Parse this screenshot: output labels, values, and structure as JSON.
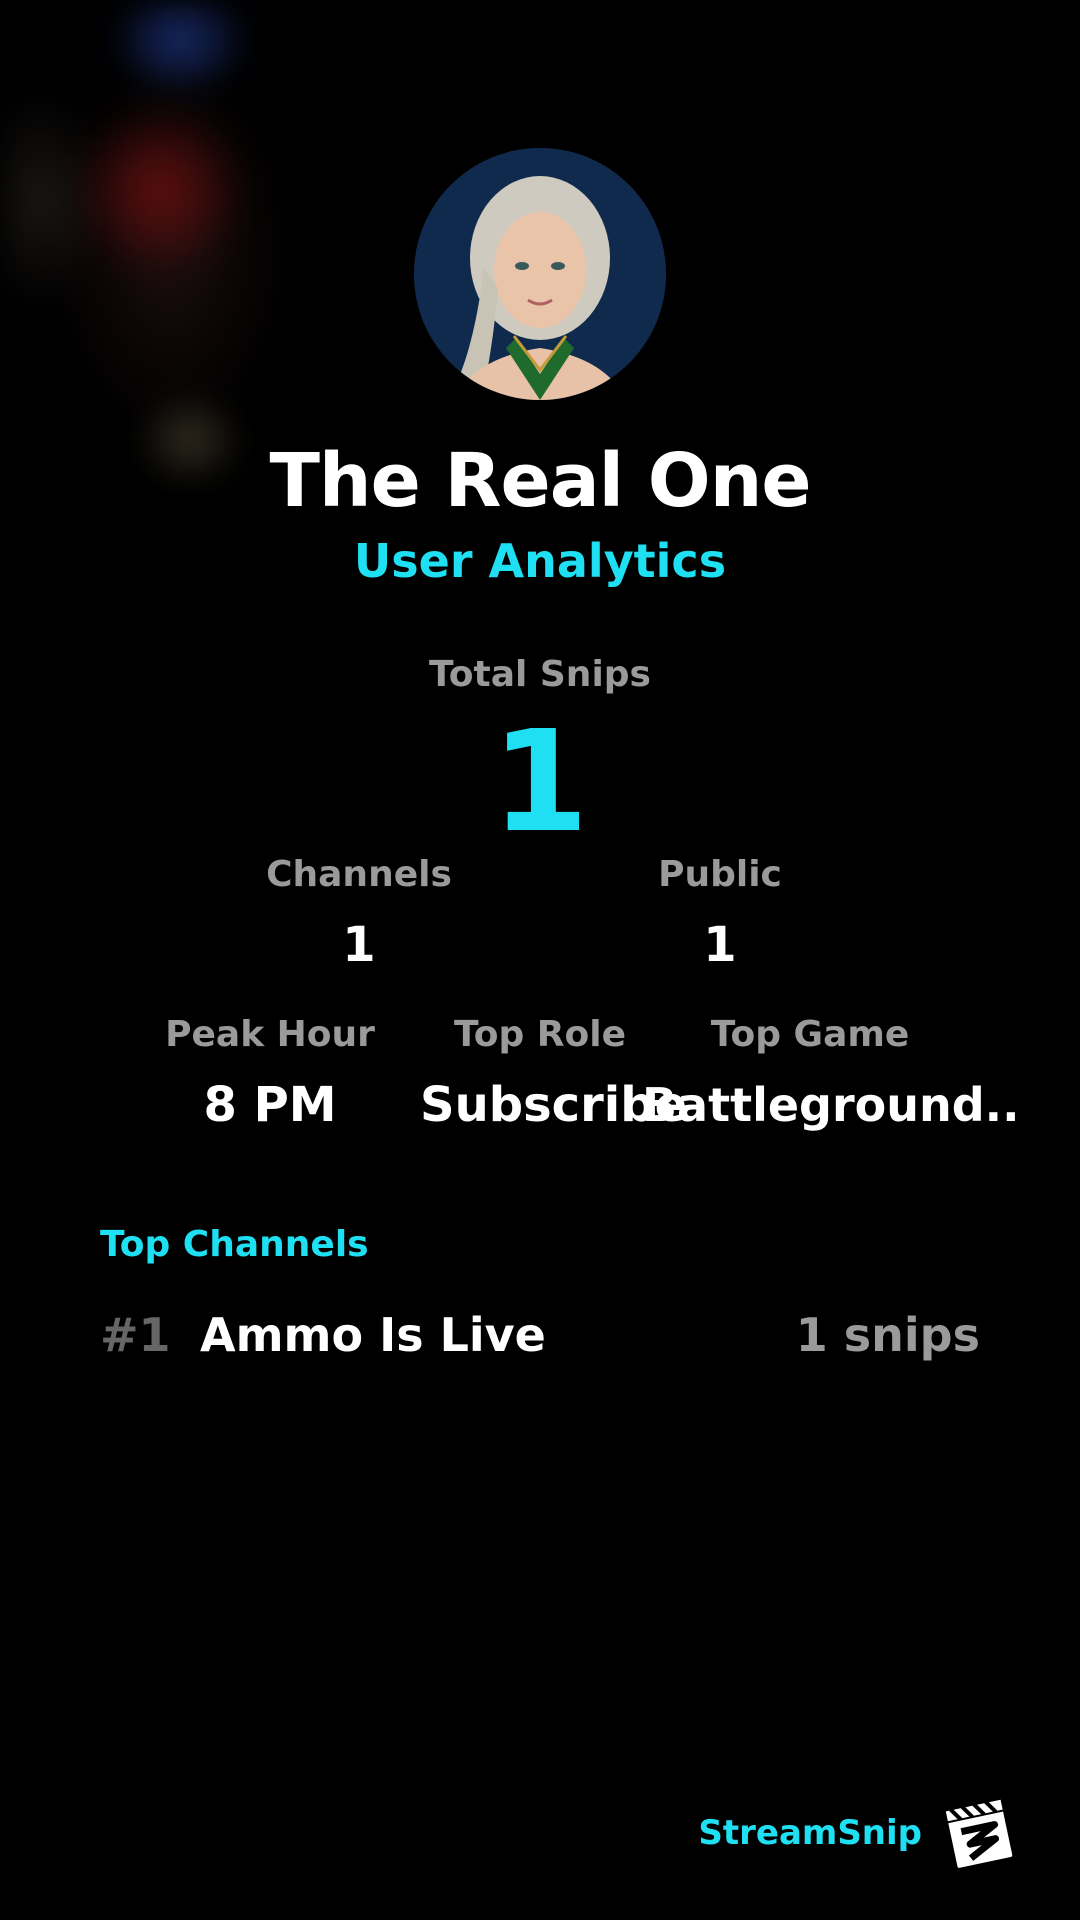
{
  "profile": {
    "name": "The Real One",
    "subtitle": "User Analytics"
  },
  "totals": {
    "total_snips_label": "Total Snips",
    "total_snips_value": "1"
  },
  "stats_row1": {
    "channels_label": "Channels",
    "channels_value": "1",
    "public_label": "Public",
    "public_value": "1"
  },
  "stats_row2": {
    "peak_hour_label": "Peak Hour",
    "peak_hour_value": "8 PM",
    "top_role_label": "Top Role",
    "top_role_value": "Subscribe",
    "top_game_label": "Top Game",
    "top_game_value": "Battleground.."
  },
  "top_channels": {
    "title": "Top Channels",
    "items": [
      {
        "rank": "#1",
        "name": "Ammo Is Live",
        "count": "1 snips"
      }
    ]
  },
  "brand": {
    "name": "StreamSnip",
    "logo_icon": "clapperboard-icon"
  },
  "colors": {
    "accent": "#1fe0f2",
    "background": "#000000",
    "muted": "#9a9a9a"
  }
}
